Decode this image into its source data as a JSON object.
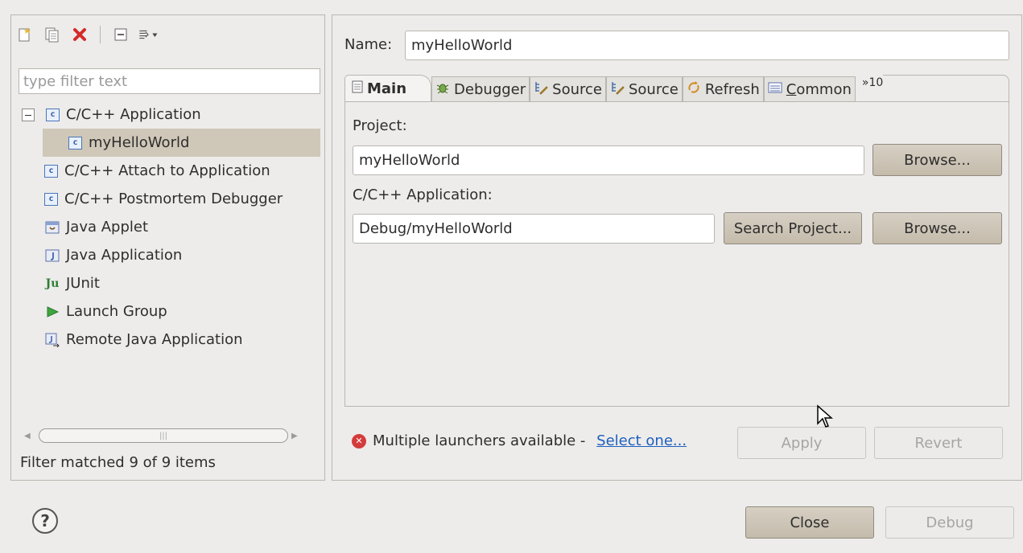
{
  "toolbar": {
    "icons": [
      "new-launch-config-icon",
      "duplicate-icon",
      "delete-icon",
      "collapse-all-icon",
      "filter-icon"
    ]
  },
  "filter": {
    "placeholder": "type filter text"
  },
  "tree": {
    "root_label": "C/C++ Application",
    "selected_child": "myHelloWorld",
    "items": [
      "C/C++ Attach to Application",
      "C/C++ Postmortem Debugger",
      "Java Applet",
      "Java Application",
      "JUnit",
      "Launch Group",
      "Remote Java Application"
    ],
    "c_icon_letter": "c",
    "junit_icon_text": "Ju"
  },
  "filter_status": "Filter matched 9 of 9 items",
  "name": {
    "label": "Name:",
    "value": "myHelloWorld"
  },
  "tabs": {
    "main": "Main",
    "debugger": "Debugger",
    "source1": "Source",
    "source2": "Source",
    "refresh": "Refresh",
    "common_c": "C",
    "common_rest": "ommon",
    "more": "»10"
  },
  "main_tab": {
    "project_label": "Project:",
    "project_value": "myHelloWorld",
    "browse1": "Browse...",
    "app_label": "C/C++ Application:",
    "app_value": "Debug/myHelloWorld",
    "search_project": "Search Project...",
    "browse2": "Browse..."
  },
  "status": {
    "message": "Multiple launchers available - ",
    "link": "Select one..."
  },
  "buttons": {
    "apply": "Apply",
    "revert": "Revert",
    "close": "Close",
    "debug": "Debug",
    "help": "?"
  },
  "colors": {
    "background": "#edeceb",
    "selection": "#cfc7b8",
    "link": "#1f5fbd",
    "error": "#d43c3c"
  }
}
